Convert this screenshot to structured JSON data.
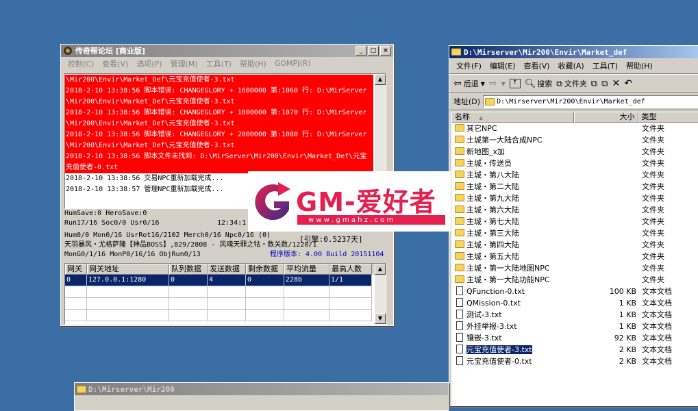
{
  "log_window": {
    "title": "传奇帮论坛 [商业版]",
    "menu": [
      "控制(C)",
      "查看(V)",
      "选项(P)",
      "管理(M)",
      "工具(T)",
      "帮助(H)",
      "GOMPJ(R)"
    ],
    "log_lines": [
      {
        "text": "\\Mir200\\Envir\\Market_Def\\元宝充值使者-3.txt",
        "error": true
      },
      {
        "text": "2018-2-10 13:38:56 脚本错误: CHANGEGLORY + 1600000 第:1060 行: D:\\MirServer",
        "error": true
      },
      {
        "text": "\\Mir200\\Envir\\Market_Def\\元宝充值使者-3.txt",
        "error": true
      },
      {
        "text": "2018-2-10 13:38:56 脚本错误: CHANGEGLORY + 1800000 第:1070 行: D:\\MirServer",
        "error": true
      },
      {
        "text": "\\Mir200\\Envir\\Market_Def\\元宝充值使者-3.txt",
        "error": true
      },
      {
        "text": "2018-2-10 13:38:56 脚本错误: CHANGEGLORY + 2000000 第:1080 行: D:\\MirServer",
        "error": true
      },
      {
        "text": "\\Mir200\\Envir\\Market_Def\\元宝充值使者-3.txt",
        "error": true
      },
      {
        "text": "2018-2-10 13:38:56 脚本文件未找到: D:\\MirServer\\Mir200\\Envir\\Market_Def\\元宝",
        "error": true
      },
      {
        "text": "充值使者-0.txt",
        "error": true
      },
      {
        "text": "2018-2-10 13:38:56 交易NPC重新加载完成...",
        "error": false
      },
      {
        "text": "2018-2-10 13:38:57 管理NPC重新加载完成...",
        "error": false
      }
    ],
    "status": {
      "line1": "HumSave:0 HeroSave:0",
      "line2": "Run17/16 Soc0/0 Usr0/16",
      "time": "12:34:1",
      "line3": "Hum0/0 Mon0/16 UsrRot16/2102 Merch0/16 Npc0/16 (0)",
      "line4": "天羽暴风・尤格萨隆【神品BOSS】,829/2808 - 风魂天罪之牯・数关数/1220/1",
      "line5": "MonG0/1/16 MonP0/16/16 ObjRun0/13",
      "overlap_text": "[引擎:0.5237天]",
      "version": "程序版本: 4.00 Build 20151104"
    },
    "grid": {
      "headers": [
        "网关",
        "网关地址",
        "队列数据",
        "发送数据",
        "剩余数据",
        "平均流量",
        "最高人数"
      ],
      "rows": [
        [
          "0",
          "127.0.0.1:1280",
          "0",
          "4",
          "0",
          "228b",
          "1/1"
        ]
      ]
    }
  },
  "explorer": {
    "title": "D:\\Mirserver\\Mir200\\Envir\\Market_def",
    "menu": [
      "文件(F)",
      "编辑(E)",
      "查看(V)",
      "收藏(A)",
      "工具(T)",
      "帮助(H)"
    ],
    "toolbar": {
      "back": "后退",
      "search": "搜索",
      "folders": "文件夹"
    },
    "address_label": "地址(D)",
    "address": "D:\\Mirserver\\Mir200\\Envir\\Market_def",
    "columns": {
      "name": "名称",
      "size": "大小",
      "type": "类型"
    },
    "items": [
      {
        "name": "其它NPC",
        "size": "",
        "type": "文件夹",
        "kind": "folder"
      },
      {
        "name": "土城第一大陆合成NPC",
        "size": "",
        "type": "文件夹",
        "kind": "folder"
      },
      {
        "name": "新地图_x加",
        "size": "",
        "type": "文件夹",
        "kind": "folder"
      },
      {
        "name": "主城・传送员",
        "size": "",
        "type": "文件夹",
        "kind": "folder"
      },
      {
        "name": "主城・第八大陆",
        "size": "",
        "type": "文件夹",
        "kind": "folder"
      },
      {
        "name": "主城・第二大陆",
        "size": "",
        "type": "文件夹",
        "kind": "folder"
      },
      {
        "name": "主城・第九大陆",
        "size": "",
        "type": "文件夹",
        "kind": "folder"
      },
      {
        "name": "主城・第六大陆",
        "size": "",
        "type": "文件夹",
        "kind": "folder"
      },
      {
        "name": "主城・第七大陆",
        "size": "",
        "type": "文件夹",
        "kind": "folder"
      },
      {
        "name": "主城・第三大陆",
        "size": "",
        "type": "文件夹",
        "kind": "folder"
      },
      {
        "name": "主城・第四大陆",
        "size": "",
        "type": "文件夹",
        "kind": "folder"
      },
      {
        "name": "主城・第五大陆",
        "size": "",
        "type": "文件夹",
        "kind": "folder"
      },
      {
        "name": "主城・第一大陆地图NPC",
        "size": "",
        "type": "文件夹",
        "kind": "folder"
      },
      {
        "name": "主城・第一大陆功能NPC",
        "size": "",
        "type": "文件夹",
        "kind": "folder"
      },
      {
        "name": "QFunction-0.txt",
        "size": "100 KB",
        "type": "文本文档",
        "kind": "file"
      },
      {
        "name": "QMission-0.txt",
        "size": "1 KB",
        "type": "文本文档",
        "kind": "file"
      },
      {
        "name": "测试-3.txt",
        "size": "1 KB",
        "type": "文本文档",
        "kind": "file"
      },
      {
        "name": "外挂举报-3.txt",
        "size": "1 KB",
        "type": "文本文档",
        "kind": "file"
      },
      {
        "name": "镶嵌-3.txt",
        "size": "92 KB",
        "type": "文本文档",
        "kind": "file"
      },
      {
        "name": "元宝充值使者-3.txt",
        "size": "2 KB",
        "type": "文本文档",
        "kind": "file",
        "selected": true
      },
      {
        "name": "元宝充值使者-0.txt",
        "size": "2 KB",
        "type": "文本文档",
        "kind": "file"
      }
    ]
  },
  "bottom_window": {
    "title": "D:\\Mirserver\\Mir200"
  },
  "watermark": {
    "text": "GM-爱好者",
    "url": "w w w . g m a h z . c o m",
    "letter": "G"
  },
  "colors": {
    "desktop": "#3a6ea5",
    "error_bg": "#ff0000",
    "selection": "#0a246a",
    "brand": "#e5204f"
  }
}
